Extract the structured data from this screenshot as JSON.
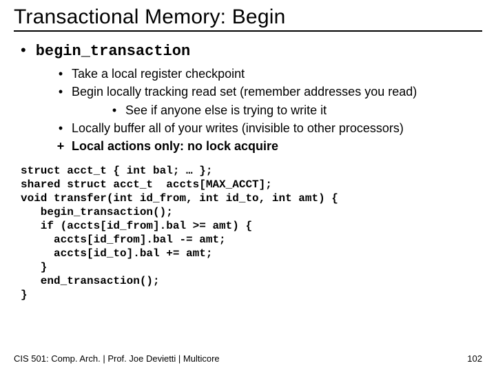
{
  "title": "Transactional Memory: Begin",
  "func": "begin_transaction",
  "b": {
    "i1": "Take a local register checkpoint",
    "i2": "Begin locally tracking read set (remember addresses you read)",
    "i2a": "See if anyone else is trying to write it",
    "i3": "Locally buffer all of your writes (invisible to other processors)",
    "i4": "Local actions only: no lock acquire"
  },
  "code": "struct acct_t { int bal; … };\nshared struct acct_t  accts[MAX_ACCT];\nvoid transfer(int id_from, int id_to, int amt) {\n   begin_transaction();\n   if (accts[id_from].bal >= amt) {\n     accts[id_from].bal -= amt;\n     accts[id_to].bal += amt;\n   }\n   end_transaction();\n}",
  "footer_left": "CIS 501: Comp. Arch.  |  Prof. Joe Devietti  |  Multicore",
  "footer_right": "102"
}
